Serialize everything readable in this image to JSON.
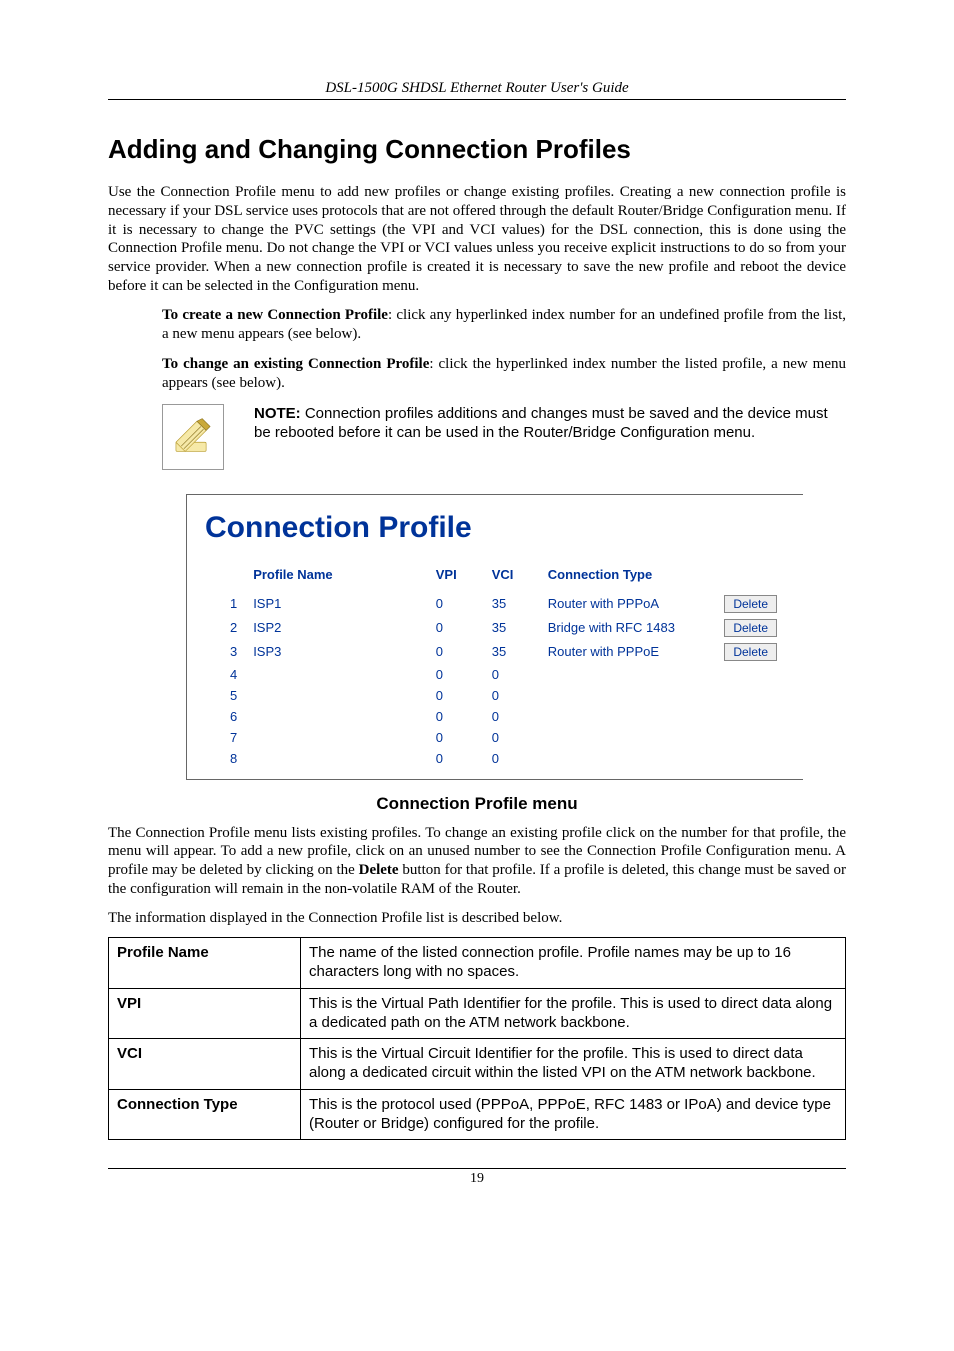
{
  "running_head": "DSL-1500G SHDSL Ethernet Router User's Guide",
  "section_title": "Adding and Changing Connection Profiles",
  "intro": "Use the Connection Profile menu to add new profiles or change existing profiles. Creating a new connection profile is necessary if your DSL service uses protocols that are not offered through the default Router/Bridge Configuration menu. If it is necessary to change the PVC settings (the VPI and VCI values) for the DSL connection, this is done using the Connection Profile menu. Do not change the VPI or VCI values unless you receive explicit instructions to do so from your service provider. When a new connection profile is created it is necessary to save the new profile and reboot the device before it can be selected in the Configuration menu.",
  "create_bold": "To create a new Connection Profile",
  "create_rest": ": click any hyperlinked index number for an undefined profile from the list, a new menu appears (see below).",
  "change_bold": "To change an existing Connection Profile",
  "change_rest": ": click the hyperlinked index number the listed profile, a new menu appears (see below).",
  "note_bold": "NOTE:",
  "note_rest": " Connection profiles additions and changes must be saved and the device must be rebooted before it can be used in the Router/Bridge Configuration menu.",
  "cp": {
    "title": "Connection Profile",
    "headers": {
      "name": "Profile Name",
      "vpi": "VPI",
      "vci": "VCI",
      "ctype": "Connection Type"
    },
    "delete_label": "Delete",
    "rows": [
      {
        "idx": "1",
        "name": "ISP1",
        "vpi": "0",
        "vci": "35",
        "ctype": "Router with PPPoA",
        "has_delete": true
      },
      {
        "idx": "2",
        "name": "ISP2",
        "vpi": "0",
        "vci": "35",
        "ctype": "Bridge with RFC 1483",
        "has_delete": true
      },
      {
        "idx": "3",
        "name": "ISP3",
        "vpi": "0",
        "vci": "35",
        "ctype": "Router with PPPoE",
        "has_delete": true
      },
      {
        "idx": "4",
        "name": "",
        "vpi": "0",
        "vci": "0",
        "ctype": "",
        "has_delete": false
      },
      {
        "idx": "5",
        "name": "",
        "vpi": "0",
        "vci": "0",
        "ctype": "",
        "has_delete": false
      },
      {
        "idx": "6",
        "name": "",
        "vpi": "0",
        "vci": "0",
        "ctype": "",
        "has_delete": false
      },
      {
        "idx": "7",
        "name": "",
        "vpi": "0",
        "vci": "0",
        "ctype": "",
        "has_delete": false
      },
      {
        "idx": "8",
        "name": "",
        "vpi": "0",
        "vci": "0",
        "ctype": "",
        "has_delete": false
      }
    ]
  },
  "figure_caption": "Connection Profile menu",
  "after1_pre": "The Connection Profile menu lists existing profiles. To change an existing profile click on the number for that profile, the menu will appear. To add a new profile, click on an unused number to see the Connection Profile Configuration menu. A profile may be deleted by clicking on the ",
  "after1_bold": "Delete",
  "after1_post": " button for that profile. If a profile is deleted, this change must be saved or the configuration will remain in the non-volatile RAM of the Router.",
  "after2": "The information displayed in the Connection Profile list is described below.",
  "desc": [
    {
      "label": "Profile Name",
      "text": "The name of the listed connection profile. Profile names may be up to 16 characters long with no spaces."
    },
    {
      "label": "VPI",
      "text": "This is the Virtual Path Identifier for the profile. This is used to direct data along a dedicated path on the ATM network backbone."
    },
    {
      "label": "VCI",
      "text": "This is the Virtual Circuit Identifier for the profile. This is used to direct data along a dedicated circuit within the listed VPI on the ATM network backbone."
    },
    {
      "label": "Connection Type",
      "text": "This is the protocol used (PPPoA, PPPoE, RFC 1483 or IPoA) and device type (Router or Bridge) configured for the profile."
    }
  ],
  "page_number": "19"
}
